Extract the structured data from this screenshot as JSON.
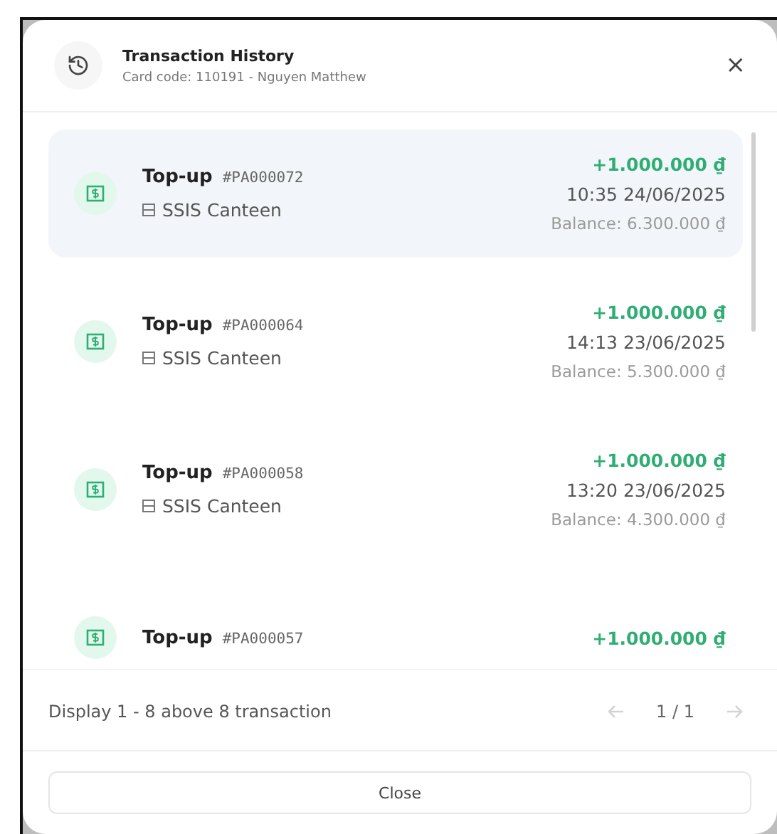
{
  "dialog": {
    "title": "Transaction History",
    "subtitle": "Card code: 110191 - Nguyen Matthew",
    "close_icon": "×"
  },
  "transactions": [
    {
      "type": "Top-up",
      "code": "#PA000072",
      "store": "SSIS Canteen",
      "amount": "+1.000.000 ₫",
      "time": "10:35 24/06/2025",
      "balance": "Balance: 6.300.000 ₫",
      "selected": true
    },
    {
      "type": "Top-up",
      "code": "#PA000064",
      "store": "SSIS Canteen",
      "amount": "+1.000.000 ₫",
      "time": "14:13 23/06/2025",
      "balance": "Balance: 5.300.000 ₫",
      "selected": false
    },
    {
      "type": "Top-up",
      "code": "#PA000058",
      "store": "SSIS Canteen",
      "amount": "+1.000.000 ₫",
      "time": "13:20 23/06/2025",
      "balance": "Balance: 4.300.000 ₫",
      "selected": false
    },
    {
      "type": "Top-up",
      "code": "#PA000057",
      "amount": "+1.000.000 ₫",
      "selected": false
    }
  ],
  "footer": {
    "summary": "Display 1 - 8 above 8 transaction",
    "page": "1 / 1",
    "prev_disabled": true,
    "next_disabled": true
  },
  "close_button": "Close"
}
